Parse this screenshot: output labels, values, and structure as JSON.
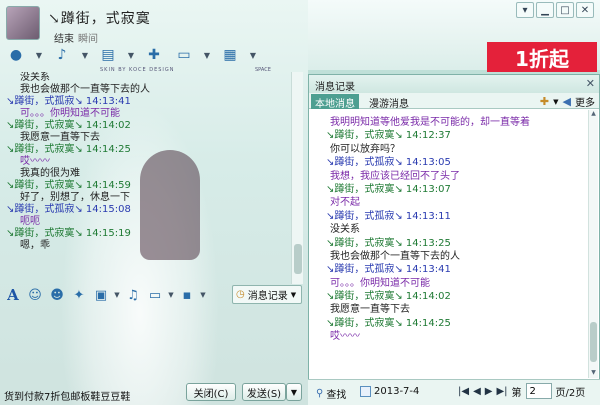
{
  "window": {
    "contact_name": "↘蹲街，式寂寞",
    "subtitle_1": "结束",
    "subtitle_2": "瞬间",
    "skin_tag": "SKIN BY KOCE DESIGN",
    "space_tag": "SPACE",
    "brand_label": "1折起"
  },
  "chat_left": {
    "lines": [
      {
        "type": "msg",
        "text": "没关系"
      },
      {
        "type": "msg",
        "text": "我也会做那个一直等下去的人"
      },
      {
        "type": "hdr-me",
        "text": "↘蹲街，式孤寂↘  14:13:41"
      },
      {
        "type": "msg-purple",
        "text": "可。。。你明知道不可能"
      },
      {
        "type": "hdr",
        "text": "↘蹲街，式寂寞↘  14:14:02"
      },
      {
        "type": "msg",
        "text": "我愿意一直等下去"
      },
      {
        "type": "hdr",
        "text": "↘蹲街，式寂寞↘  14:14:25"
      },
      {
        "type": "msg-purple",
        "text": "哎〰〰"
      },
      {
        "type": "msg",
        "text": "我真的很为难"
      },
      {
        "type": "hdr",
        "text": "↘蹲街，式寂寞↘  14:14:59"
      },
      {
        "type": "msg",
        "text": "好了，别想了，休息一下"
      },
      {
        "type": "hdr-me",
        "text": "↘蹲街，式孤寂↘  14:15:08"
      },
      {
        "type": "msg-purple",
        "text": "呃呃"
      },
      {
        "type": "hdr",
        "text": "↘蹲街，式寂寞↘  14:15:19"
      },
      {
        "type": "msg",
        "text": "嗯，乖"
      }
    ]
  },
  "toolbar2": {
    "msg_record_label": "消息记录"
  },
  "statusbar": {
    "ad_text": "货到付款7折包邮板鞋豆豆鞋",
    "close_label": "关闭(C)",
    "send_label": "发送(S)"
  },
  "panel": {
    "title": "消息记录",
    "tab_local": "本地消息",
    "tab_roam": "漫游消息",
    "more_label": "更多",
    "lines": [
      {
        "type": "msg-purple",
        "text": "我明明知道等他爱我是不可能的，却一直等着"
      },
      {
        "type": "hdr",
        "text": "↘蹲街，式寂寞↘  14:12:37"
      },
      {
        "type": "msg",
        "text": "你可以放弃吗？"
      },
      {
        "type": "hdr-me",
        "text": "↘蹲街，式孤寂↘  14:13:05"
      },
      {
        "type": "msg-purple",
        "text": "我想，我应该已经回不了头了"
      },
      {
        "type": "hdr",
        "text": "↘蹲街，式寂寞↘  14:13:07"
      },
      {
        "type": "msg-purple",
        "text": "对不起"
      },
      {
        "type": "hdr-me",
        "text": "↘蹲街，式孤寂↘  14:13:11"
      },
      {
        "type": "msg",
        "text": "没关系"
      },
      {
        "type": "hdr",
        "text": "↘蹲街，式寂寞↘  14:13:25"
      },
      {
        "type": "msg",
        "text": "我也会做那个一直等下去的人"
      },
      {
        "type": "hdr-me",
        "text": "↘蹲街，式孤寂↘  14:13:41"
      },
      {
        "type": "msg-purple",
        "text": "可。。。你明知道不可能"
      },
      {
        "type": "hdr",
        "text": "↘蹲街，式寂寞↘  14:14:02"
      },
      {
        "type": "msg",
        "text": "我愿意一直等下去"
      },
      {
        "type": "hdr",
        "text": "↘蹲街，式寂寞↘  14:14:25"
      },
      {
        "type": "msg-purple",
        "text": "哎〰〰"
      }
    ]
  },
  "footer": {
    "find_label": "查找",
    "date": "2013-7-4",
    "page_prefix": "第",
    "page_value": "2",
    "page_suffix": "页/2页"
  },
  "icons": {
    "close": "✕",
    "minimize": "▁",
    "maximize": "□",
    "menu": "▾"
  }
}
